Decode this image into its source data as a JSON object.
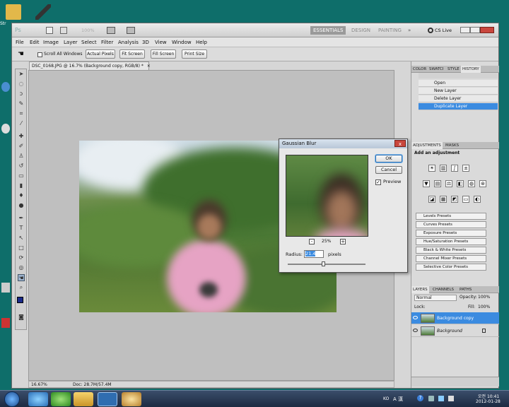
{
  "window": {
    "app_badge": "Ps",
    "zoom_display": "100%",
    "workspaces": [
      "ESSENTIALS",
      "DESIGN",
      "PAINTING"
    ],
    "more_workspaces": "»",
    "cs_live": "CS Live"
  },
  "menu": [
    "File",
    "Edit",
    "Image",
    "Layer",
    "Select",
    "Filter",
    "Analysis",
    "3D",
    "View",
    "Window",
    "Help"
  ],
  "options_bar": {
    "scroll_all_windows": "Scroll All Windows",
    "actual_pixels": "Actual Pixels",
    "fit_screen": "Fit Screen",
    "fill_screen": "Fill Screen",
    "print_size": "Print Size"
  },
  "document": {
    "tab_title": "DSC_0168.JPG @ 16.7% (Background copy, RGB/8) *",
    "close": "×",
    "zoom": "16.67%",
    "doc_info": "Doc: 28.7M/57.4M"
  },
  "panels": {
    "top_tabs": [
      "COLOR",
      "SWATCI",
      "STYLE",
      "HISTORY"
    ],
    "history": [
      {
        "label": "Open",
        "selected": false
      },
      {
        "label": "New Layer",
        "selected": false
      },
      {
        "label": "Delete Layer",
        "selected": false
      },
      {
        "label": "Duplicate Layer",
        "selected": true
      }
    ],
    "adj_tabs": [
      "ADJUSTMENTS",
      "MASKS"
    ],
    "add_adjustment": "Add an adjustment",
    "presets": [
      "Levels Presets",
      "Curves Presets",
      "Exposure Presets",
      "Hue/Saturation Presets",
      "Black & White Presets",
      "Channel Mixer Presets",
      "Selective Color Presets"
    ],
    "layer_tabs": [
      "LAYERS",
      "CHANNELS",
      "PATHS"
    ],
    "blend_mode": "Normal",
    "opacity_label": "Opacity:",
    "opacity_value": "100%",
    "lock_label": "Lock:",
    "fill_label": "Fill:",
    "fill_value": "100%",
    "layers": [
      {
        "name": "Background copy",
        "selected": true
      },
      {
        "name": "Background",
        "selected": false
      }
    ]
  },
  "dialog": {
    "title": "Gaussian Blur",
    "close": "x",
    "ok": "OK",
    "cancel": "Cancel",
    "preview_label": "Preview",
    "preview_checked": true,
    "zoom_minus": "-",
    "zoom_value": "25%",
    "zoom_plus": "+",
    "radius_label": "Radius:",
    "radius_value": "21.4",
    "radius_unit": "pixels"
  },
  "taskbar": {
    "lang": "KO",
    "ime": "A 漢",
    "time": "오전 10:41",
    "date": "2012-01-28"
  },
  "colors": {
    "desktop": "#0e6e6a",
    "selection": "#3b8be0",
    "ps_badge": "#2f6db0"
  }
}
